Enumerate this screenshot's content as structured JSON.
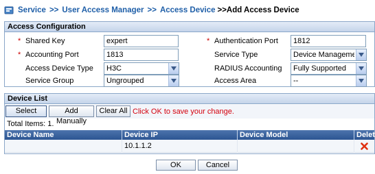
{
  "breadcrumb": {
    "items": [
      "Service",
      "User Access Manager",
      "Access Device"
    ],
    "separator": ">>",
    "current": ">>Add Access Device"
  },
  "access_config": {
    "title": "Access Configuration",
    "shared_key": {
      "label": "Shared Key",
      "value": "expert",
      "required": "*"
    },
    "auth_port": {
      "label": "Authentication Port",
      "value": "1812",
      "required": "*"
    },
    "accounting_port": {
      "label": "Accounting Port",
      "value": "1813",
      "required": "*"
    },
    "service_type": {
      "label": "Service Type",
      "value": "Device Management S"
    },
    "device_type": {
      "label": "Access Device Type",
      "value": "H3C"
    },
    "radius_accounting": {
      "label": "RADIUS Accounting",
      "value": "Fully Supported"
    },
    "service_group": {
      "label": "Service Group",
      "value": "Ungrouped"
    },
    "access_area": {
      "label": "Access Area",
      "value": "--"
    }
  },
  "device_list": {
    "title": "Device List",
    "buttons": {
      "select": "Select",
      "add_manually": "Add Manually",
      "clear_all": "Clear All"
    },
    "hint": "Click OK to save your change.",
    "total": "Total Items: 1.",
    "columns": [
      "Device Name",
      "Device IP",
      "Device Model",
      "Delete"
    ],
    "rows": [
      {
        "name": "",
        "ip": "10.1.1.2",
        "model": ""
      }
    ]
  },
  "footer": {
    "ok": "OK",
    "cancel": "Cancel"
  },
  "colors": {
    "link": "#1f5fa8",
    "required": "#cc0000",
    "hint": "#d4000d",
    "table_header": "#2c5592",
    "delete_icon": "#e03010"
  },
  "icons": {
    "breadcrumb": "settings-icon",
    "delete": "delete-x-icon"
  }
}
